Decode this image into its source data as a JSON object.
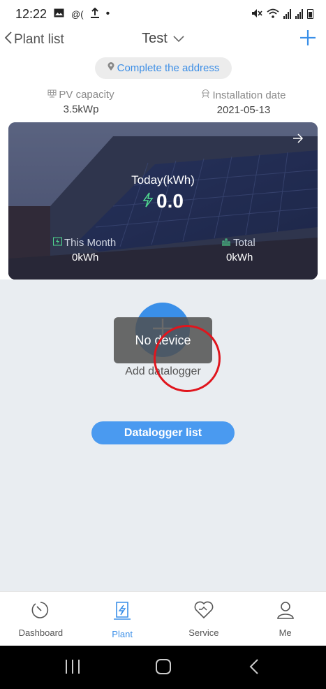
{
  "status_bar": {
    "time": "12:22",
    "left_icons": [
      "image-icon",
      "at-icon",
      "upload-icon",
      "dot-icon"
    ],
    "right_icons": [
      "mute-icon",
      "wifi-icon",
      "signal-icon",
      "signal-icon",
      "battery-icon"
    ]
  },
  "header": {
    "back_label": "Plant list",
    "title": "Test",
    "add_icon": "plus-icon"
  },
  "address": {
    "label": "Complete the address"
  },
  "info": {
    "pv_capacity_label": "PV capacity",
    "pv_capacity_value": "3.5kWp",
    "installation_date_label": "Installation date",
    "installation_date_value": "2021-05-13"
  },
  "solar_card": {
    "today_label": "Today(kWh)",
    "today_value": "0.0",
    "month_label": "This Month",
    "month_value": "0kWh",
    "total_label": "Total",
    "total_value": "0kWh"
  },
  "devices": {
    "toast": "No device",
    "add_datalogger_label": "Add datalogger",
    "datalogger_list_button": "Datalogger list"
  },
  "bottom_nav": {
    "items": [
      {
        "label": "Dashboard",
        "icon": "dashboard-icon",
        "active": false
      },
      {
        "label": "Plant",
        "icon": "plant-icon",
        "active": true
      },
      {
        "label": "Service",
        "icon": "service-icon",
        "active": false
      },
      {
        "label": "Me",
        "icon": "user-icon",
        "active": false
      }
    ]
  },
  "colors": {
    "accent": "#3a8fe8",
    "annotation_circle": "#e0151d",
    "content_bg": "#e9edf1"
  }
}
